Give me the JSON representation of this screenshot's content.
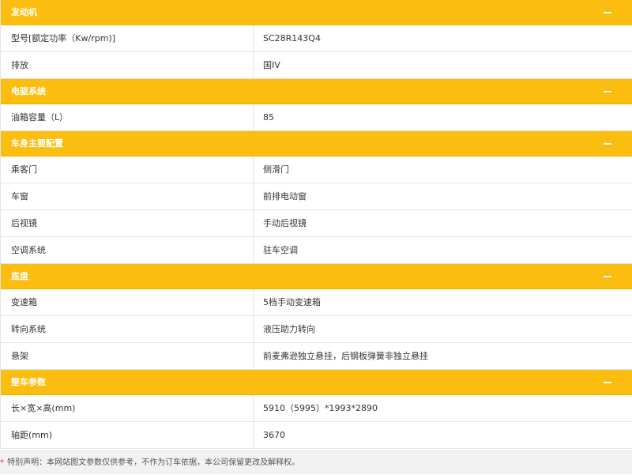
{
  "sections": [
    {
      "title": "发动机",
      "rows": [
        {
          "label": "型号[额定功率（Kw/rpm)]",
          "value": "SC28R143Q4"
        },
        {
          "label": "排放",
          "value": "国IV"
        }
      ]
    },
    {
      "title": "电驱系统",
      "rows": [
        {
          "label": "油箱容量（L）",
          "value": "85"
        }
      ]
    },
    {
      "title": "车身主要配置",
      "rows": [
        {
          "label": "乘客门",
          "value": "侧滑门"
        },
        {
          "label": "车窗",
          "value": "前排电动窗"
        },
        {
          "label": "后视镜",
          "value": "手动后视镜"
        },
        {
          "label": "空调系统",
          "value": "驻车空调"
        }
      ]
    },
    {
      "title": "底盘",
      "rows": [
        {
          "label": "变速箱",
          "value": "5档手动变速箱"
        },
        {
          "label": "转向系统",
          "value": "液压助力转向"
        },
        {
          "label": "悬架",
          "value": "前麦弗逊独立悬挂，后钢板弹簧非独立悬挂"
        }
      ]
    },
    {
      "title": "整车参数",
      "rows": [
        {
          "label": "长×宽×高(mm)",
          "value": "5910（5995）*1993*2890"
        },
        {
          "label": "轴距(mm)",
          "value": "3670"
        }
      ]
    }
  ],
  "footer": {
    "asterisk": "*",
    "note": " 特别声明：本网站图文参数仅供参考，不作为订车依据，本公司保留更改及解释权。"
  },
  "colors": {
    "header_bg": "#fbbd10",
    "header_text": "#ffffff",
    "border": "#e4e4e4",
    "asterisk": "#e33a2e",
    "footer_bg": "#f2f2f2"
  },
  "icons": {
    "collapse": "minus-icon"
  }
}
